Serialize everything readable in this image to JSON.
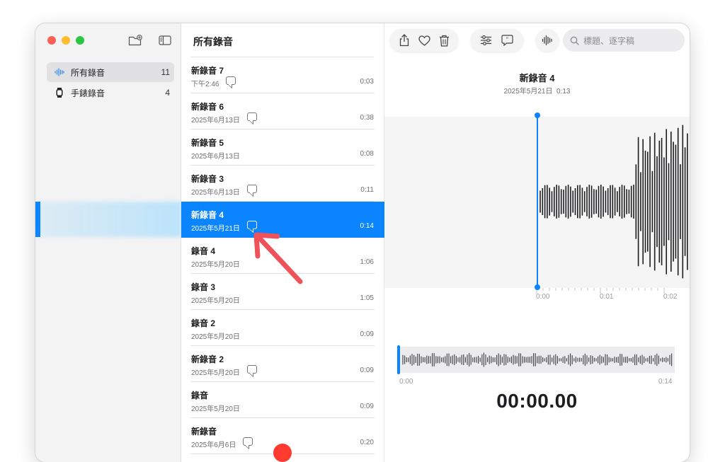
{
  "sidebar": {
    "items": [
      {
        "label": "所有錄音",
        "count": "11",
        "icon": "waveform-icon"
      },
      {
        "label": "手錶錄音",
        "count": "4",
        "icon": "watch-icon"
      }
    ]
  },
  "list": {
    "title": "所有錄音",
    "rows": [
      {
        "title": "新錄音 7",
        "date": "下午2:46",
        "duration": "0:03",
        "transcript": true
      },
      {
        "title": "新錄音 6",
        "date": "2025年6月13日",
        "duration": "0:38",
        "transcript": true
      },
      {
        "title": "新錄音 5",
        "date": "2025年6月13日",
        "duration": "0:08",
        "transcript": false
      },
      {
        "title": "新錄音 3",
        "date": "2025年6月13日",
        "duration": "0:11",
        "transcript": true
      },
      {
        "title": "新錄音 4",
        "date": "2025年5月21日",
        "duration": "0:14",
        "transcript": true,
        "selected": true
      },
      {
        "title": "錄音 4",
        "date": "2025年5月20日",
        "duration": "1:06",
        "transcript": false
      },
      {
        "title": "錄音 3",
        "date": "2025年5月20日",
        "duration": "1:05",
        "transcript": false
      },
      {
        "title": "錄音 2",
        "date": "2025年5月20日",
        "duration": "0:09",
        "transcript": false
      },
      {
        "title": "新錄音 2",
        "date": "2025年5月20日",
        "duration": "0:09",
        "transcript": true
      },
      {
        "title": "錄音",
        "date": "2025年5月20日",
        "duration": "0:09",
        "transcript": false
      },
      {
        "title": "新錄音",
        "date": "2025年6月6日",
        "duration": "0:20",
        "transcript": true
      }
    ]
  },
  "toolbar": {
    "search_placeholder": "標題、逐字稿"
  },
  "detail": {
    "title": "新錄音 4",
    "date": "2025年5月21日",
    "length": "0:13",
    "ticks": [
      "0:00",
      "0:01",
      "0:02"
    ],
    "mini_start": "0:00",
    "mini_end": "0:14",
    "timer": "00:00.00"
  },
  "colors": {
    "accent": "#0a84ff",
    "annotation_arrow": "#f0525a"
  }
}
